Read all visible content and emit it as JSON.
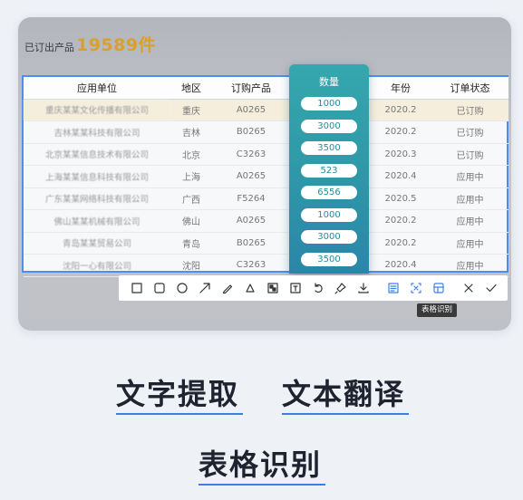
{
  "header": {
    "label": "已订出产品",
    "count": "19589件"
  },
  "table": {
    "columns": [
      "应用单位",
      "地区",
      "订购产品",
      "数量",
      "年份",
      "订单状态"
    ],
    "rows": [
      {
        "unit": "重庆某某文化传播有限公司",
        "region": "重庆",
        "product": "A0265",
        "qty": "1000",
        "year": "2020.2",
        "status": "已订购"
      },
      {
        "unit": "吉林某某科技有限公司",
        "region": "吉林",
        "product": "B0265",
        "qty": "3000",
        "year": "2020.2",
        "status": "已订购"
      },
      {
        "unit": "北京某某信息技术有限公司",
        "region": "北京",
        "product": "C3263",
        "qty": "3500",
        "year": "2020.3",
        "status": "已订购"
      },
      {
        "unit": "上海某某信息科技有限公司",
        "region": "上海",
        "product": "A0265",
        "qty": "523",
        "year": "2020.4",
        "status": "应用中"
      },
      {
        "unit": "广东某某网络科技有限公司",
        "region": "广西",
        "product": "F5264",
        "qty": "6556",
        "year": "2020.5",
        "status": "应用中"
      },
      {
        "unit": "佛山某某机械有限公司",
        "region": "佛山",
        "product": "A0265",
        "qty": "1000",
        "year": "2020.2",
        "status": "应用中"
      },
      {
        "unit": "青岛某某贸易公司",
        "region": "青岛",
        "product": "B0265",
        "qty": "3000",
        "year": "2020.2",
        "status": "应用中"
      },
      {
        "unit": "沈阳一心有限公司",
        "region": "沈阳",
        "product": "C3263",
        "qty": "3500",
        "year": "2020.4",
        "status": "应用中"
      }
    ]
  },
  "toolbar": {
    "tools": [
      "rectangle-icon",
      "rounded-rectangle-icon",
      "circle-icon",
      "arrow-icon",
      "pen-icon",
      "fill-icon",
      "mosaic-icon",
      "text-icon",
      "undo-icon",
      "pin-icon",
      "download-icon",
      "ocr-icon",
      "translate-icon",
      "table-recognition-icon",
      "close-icon",
      "confirm-icon"
    ],
    "tooltip": "表格识别",
    "accent": "#3f82e6"
  },
  "features": {
    "text_extract": "文字提取",
    "text_translate": "文本翻译",
    "table_recognize": "表格识别",
    "underline_color": "#3b7fe0"
  }
}
